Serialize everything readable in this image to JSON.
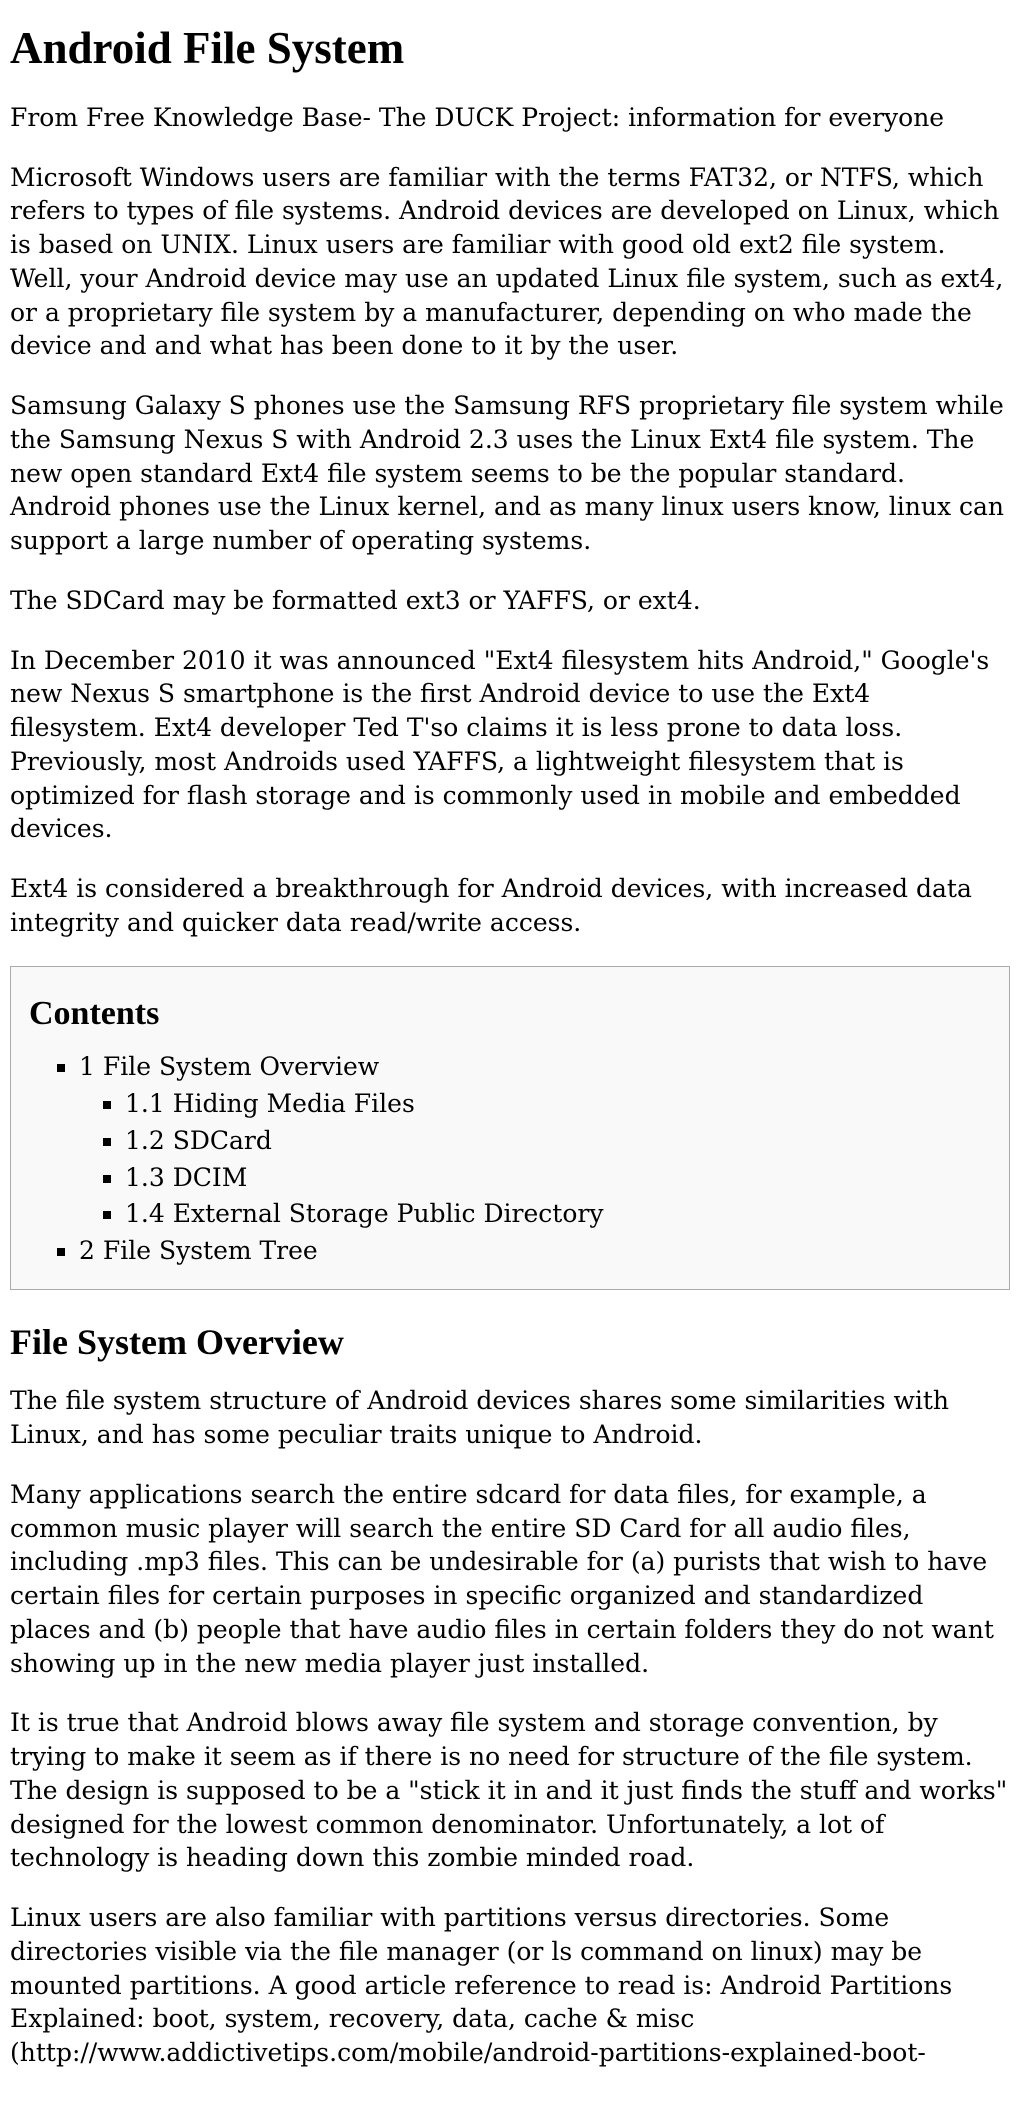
{
  "title": "Android File System",
  "subtitle": "From Free Knowledge Base- The DUCK Project: information for everyone",
  "intro": {
    "p1": "Microsoft Windows users are familiar with the terms FAT32, or NTFS, which refers to types of file systems. Android devices are developed on Linux, which is based on UNIX. Linux users are familiar with good old ext2 file system. Well, your Android device may use an updated Linux file system, such as ext4, or a proprietary file system by a manufacturer, depending on who made the device and and what has been done to it by the user.",
    "p2": "Samsung Galaxy S phones use the Samsung RFS proprietary file system while the Samsung Nexus S with Android 2.3 uses the Linux Ext4 file system. The new open standard Ext4 file system seems to be the popular standard. Android phones use the Linux kernel, and as many linux users know, linux can support a large number of operating systems.",
    "p3": "The SDCard may be formatted ext3 or YAFFS, or ext4.",
    "p4": "In December 2010 it was announced \"Ext4 filesystem hits Android,\" Google's new Nexus S smartphone is the first Android device to use the Ext4 filesystem. Ext4 developer Ted T'so claims it is less prone to data loss. Previously, most Androids used YAFFS, a lightweight filesystem that is optimized for flash storage and is commonly used in mobile and embedded devices.",
    "p5": "Ext4 is considered a breakthrough for Android devices, with increased data integrity and quicker data read/write access."
  },
  "toc": {
    "heading": "Contents",
    "items": [
      {
        "num": "1",
        "text": "File System Overview",
        "children": [
          {
            "num": "1.1",
            "text": "Hiding Media Files"
          },
          {
            "num": "1.2",
            "text": "SDCard"
          },
          {
            "num": "1.3",
            "text": "DCIM"
          },
          {
            "num": "1.4",
            "text": "External Storage Public Directory"
          }
        ]
      },
      {
        "num": "2",
        "text": "File System Tree",
        "children": []
      }
    ]
  },
  "section1": {
    "heading": "File System Overview",
    "p1": "The file system structure of Android devices shares some similarities with Linux, and has some peculiar traits unique to Android.",
    "p2": "Many applications search the entire sdcard for data files, for example, a common music player will search the entire SD Card for all audio files, including .mp3 files. This can be undesirable for (a) purists that wish to have certain files for certain purposes in specific organized and standardized places and (b) people that have audio files in certain folders they do not want showing up in the new media player just installed.",
    "p3": "It is true that Android blows away file system and storage convention, by trying to make it seem as if there is no need for structure of the file system. The design is supposed to be a \"stick it in and it just finds the stuff and works\" designed for the lowest common denominator. Unfortunately, a lot of technology is heading down this zombie minded road.",
    "p4": "Linux users are also familiar with partitions versus directories. Some directories visible via the file manager (or ls command on linux) may be mounted partitions. A good article reference to read is: Android Partitions Explained: boot, system, recovery, data, cache & misc (http://www.addictivetips.com/mobile/android-partitions-explained-boot-"
  }
}
